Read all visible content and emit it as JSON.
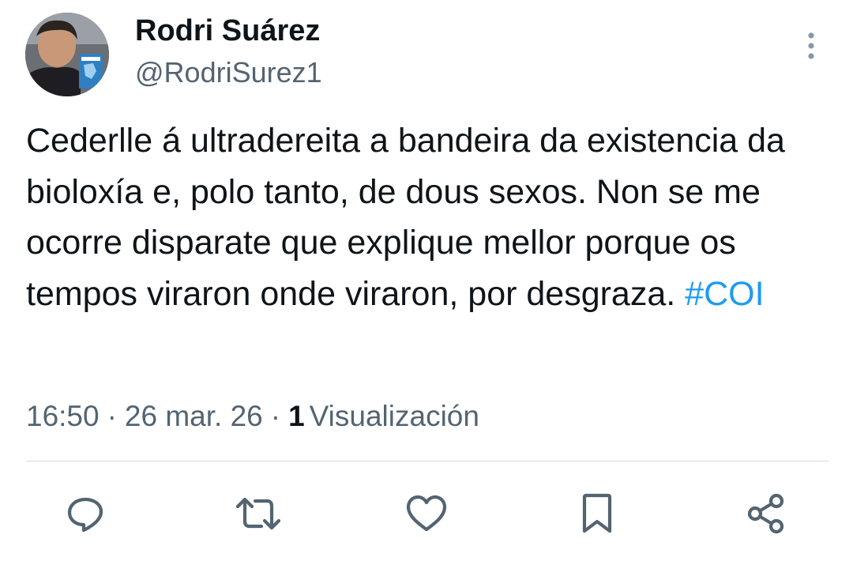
{
  "author": {
    "display_name": "Rodri Suárez",
    "handle": "@RodriSurez1",
    "avatar_icon": "profile-photo"
  },
  "tweet": {
    "text": "Cederlle á ultradereita a bandeira da existencia da bioloxía e, polo tanto, de dous sexos. Non se me ocorre disparate que explique mellor porque os tempos viraron onde viraron, por desgraza. ",
    "hashtag": "#COI"
  },
  "meta": {
    "time": "16:50",
    "separator": "·",
    "date": "26 mar. 26",
    "views_count": "1",
    "views_label": "Visualización"
  },
  "actions": {
    "reply_icon": "reply-icon",
    "retweet_icon": "retweet-icon",
    "like_icon": "like-icon",
    "bookmark_icon": "bookmark-icon",
    "share_icon": "share-icon"
  },
  "colors": {
    "text_primary": "#0f1419",
    "text_secondary": "#536471",
    "link": "#1d9bf0",
    "divider": "#cfd9de"
  }
}
